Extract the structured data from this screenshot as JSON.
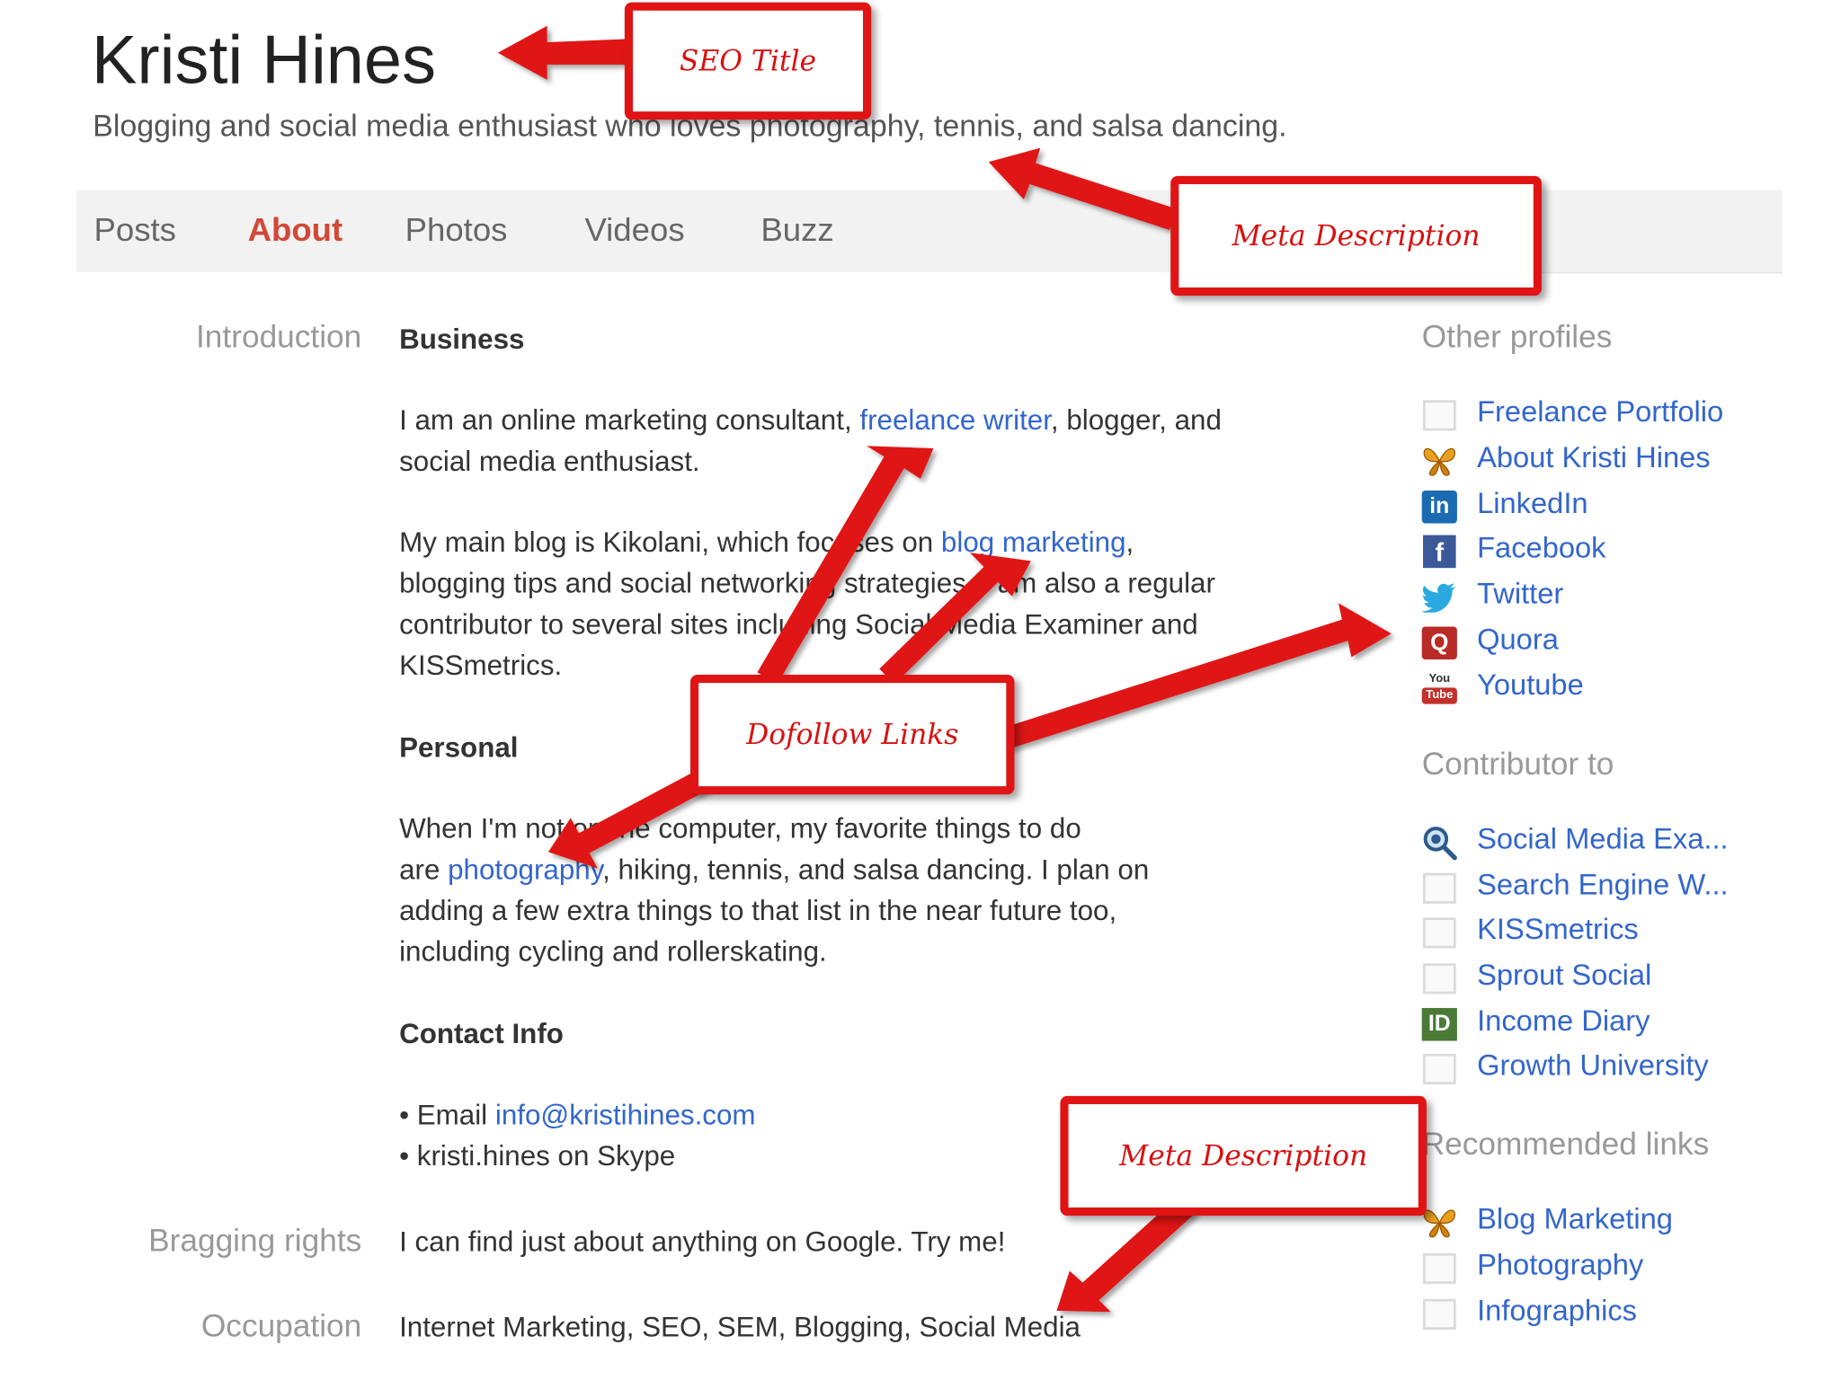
{
  "profile": {
    "name": "Kristi Hines",
    "tagline": "Blogging and social media enthusiast who loves photography, tennis, and salsa dancing."
  },
  "tabs": [
    {
      "label": "Posts"
    },
    {
      "label": "About",
      "active": true
    },
    {
      "label": "Photos"
    },
    {
      "label": "Videos"
    },
    {
      "label": "Buzz"
    }
  ],
  "about": {
    "introduction_label": "Introduction",
    "business_heading": "Business",
    "business_p1_a": "I am an online marketing consultant, ",
    "business_p1_link": "freelance writer",
    "business_p1_b": ", blogger, and",
    "business_p1_line2": "social media enthusiast.",
    "business_p2_a": "My main blog is Kikolani, which focuses on ",
    "business_p2_link": "blog marketing",
    "business_p2_b": ",",
    "business_p2_line2": "blogging tips and social networking strategies. I am also a regular",
    "business_p2_line3": "contributor to several sites including Social Media Examiner and",
    "business_p2_line4": "KISSmetrics.",
    "personal_heading": "Personal",
    "personal_line1": "When I'm not on the computer, my favorite things to do",
    "personal_line2_a": "are ",
    "personal_line2_link": "photography",
    "personal_line2_b": ", hiking, tennis, and salsa dancing.  I plan on",
    "personal_line3": "adding a few extra things to that list in the near future too,",
    "personal_line4": "including cycling and rollerskating.",
    "contact_heading": "Contact Info",
    "contact_email_prefix": "• Email ",
    "contact_email": "info@kristihines.com",
    "contact_skype": "• kristi.hines on Skype",
    "bragging_label": "Bragging rights",
    "bragging_value": "I can find just about anything on Google. Try me!",
    "occupation_label": "Occupation",
    "occupation_value": "Internet Marketing, SEO, SEM, Blogging, Social Media"
  },
  "sidebar": {
    "other_profiles_heading": "Other profiles",
    "other_profiles": [
      {
        "label": "Freelance Portfolio",
        "icon": "blank-page-icon"
      },
      {
        "label": "About Kristi Hines",
        "icon": "butterfly-icon"
      },
      {
        "label": "LinkedIn",
        "icon": "linkedin-icon"
      },
      {
        "label": "Facebook",
        "icon": "facebook-icon"
      },
      {
        "label": "Twitter",
        "icon": "twitter-bird-icon"
      },
      {
        "label": "Quora",
        "icon": "quora-icon"
      },
      {
        "label": "Youtube",
        "icon": "youtube-icon"
      }
    ],
    "contributor_heading": "Contributor to",
    "contributor_to": [
      {
        "label": "Social Media Exa...",
        "icon": "magnifier-icon"
      },
      {
        "label": "Search Engine W...",
        "icon": "blank-page-icon"
      },
      {
        "label": "KISSmetrics",
        "icon": "blank-page-icon"
      },
      {
        "label": "Sprout Social",
        "icon": "blank-page-icon"
      },
      {
        "label": "Income Diary",
        "icon": "id-icon"
      },
      {
        "label": "Growth University",
        "icon": "blank-page-icon"
      }
    ],
    "recommended_heading": "Recommended links",
    "recommended_links": [
      {
        "label": "Blog Marketing",
        "icon": "butterfly-icon"
      },
      {
        "label": "Photography",
        "icon": "blank-page-icon"
      },
      {
        "label": "Infographics",
        "icon": "blank-page-icon"
      }
    ]
  },
  "callouts": {
    "seo_title": "SEO Title",
    "meta_description_top": "Meta Description",
    "dofollow_links": "Dofollow Links",
    "meta_description_bottom": "Meta Description"
  },
  "colors": {
    "annotation_red": "#e01414",
    "link_blue": "#3366cc",
    "active_tab": "#d14836"
  }
}
